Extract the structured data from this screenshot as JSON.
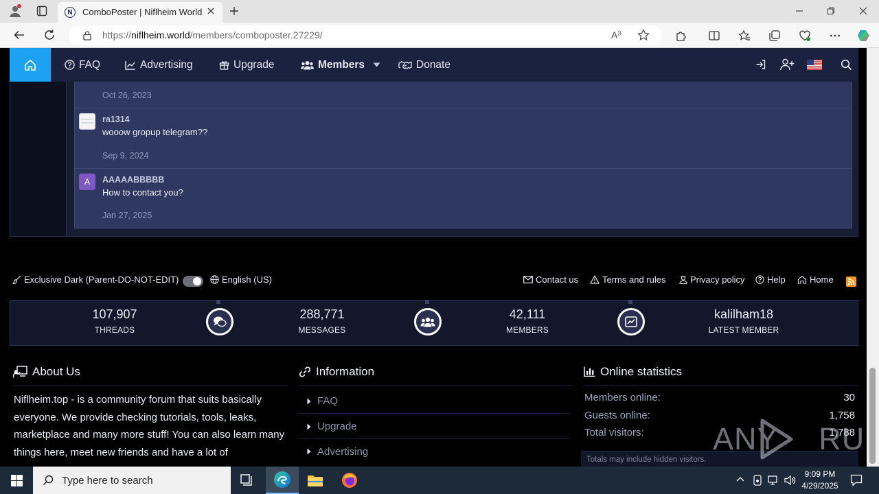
{
  "browser": {
    "tab_title": "ComboPoster | Niflheim World",
    "url_prefix": "https://",
    "url_domain": "niflheim.world",
    "url_path": "/members/comboposter.27229/"
  },
  "nav": {
    "faq": "FAQ",
    "advertising": "Advertising",
    "upgrade": "Upgrade",
    "members": "Members",
    "donate": "Donate"
  },
  "comments": [
    {
      "date": "Oct 26, 2023"
    },
    {
      "username": "ra1314",
      "text": "wooow gropup telegram??",
      "date": "Sep 9, 2024"
    },
    {
      "username": "AAAAABBBBB",
      "avatar_letter": "A",
      "text": "How to contact you?",
      "date": "Jan 27, 2025"
    }
  ],
  "footer": {
    "style_name": "Exclusive Dark (Parent-DO-NOT-EDIT)",
    "language": "English (US)",
    "contact": "Contact us",
    "terms": "Terms and rules",
    "privacy": "Privacy policy",
    "help": "Help",
    "home": "Home"
  },
  "stats": [
    {
      "value": "107,907",
      "label": "THREADS"
    },
    {
      "value": "288,771",
      "label": "MESSAGES"
    },
    {
      "value": "42,111",
      "label": "MEMBERS"
    },
    {
      "value": "kalilham18",
      "label": "LATEST MEMBER"
    }
  ],
  "about": {
    "title": "About Us",
    "text": "Niflheim.top - is a community forum that suits basically everyone. We provide checking tutorials, tools, leaks, marketplace and many more stuff! You can also learn many things here, meet new friends and have a lot of"
  },
  "information": {
    "title": "Information",
    "items": [
      "FAQ",
      "Upgrade",
      "Advertising"
    ]
  },
  "online": {
    "title": "Online statistics",
    "members_label": "Members online:",
    "members_value": "30",
    "guests_label": "Guests online:",
    "guests_value": "1,758",
    "total_label": "Total visitors:",
    "total_value": "1,788",
    "note": "Totals may include hidden visitors."
  },
  "watermark": "ANY RUN",
  "taskbar": {
    "search_placeholder": "Type here to search",
    "time": "9:09 PM",
    "date": "4/29/2025"
  }
}
